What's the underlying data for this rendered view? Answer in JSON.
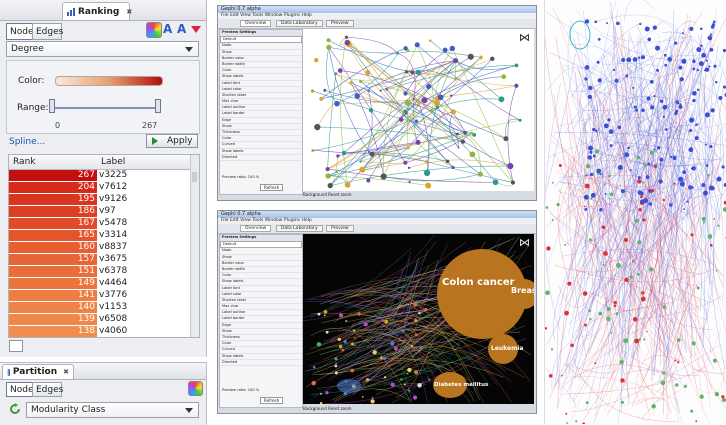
{
  "ranking_panel": {
    "title": "Ranking",
    "close": "✖",
    "tabs": [
      "Nodes",
      "Edges"
    ],
    "attribute": "Degree",
    "color_label": "Color:",
    "range_label": "Range:",
    "range_min": "0",
    "range_max": "267",
    "spline_link": "Spline...",
    "apply_label": "Apply",
    "columns": [
      "Rank",
      "Label"
    ],
    "rows": [
      {
        "rank": "267",
        "label": "v3225",
        "color": "#c40f0f"
      },
      {
        "rank": "204",
        "label": "v7612",
        "color": "#d62a1b"
      },
      {
        "rank": "195",
        "label": "v9126",
        "color": "#da3520"
      },
      {
        "rank": "186",
        "label": "v97",
        "color": "#dd3f23"
      },
      {
        "rank": "167",
        "label": "v5478",
        "color": "#e14b28"
      },
      {
        "rank": "165",
        "label": "v3314",
        "color": "#e4552c"
      },
      {
        "rank": "160",
        "label": "v8837",
        "color": "#e65e31"
      },
      {
        "rank": "157",
        "label": "v3675",
        "color": "#e86635"
      },
      {
        "rank": "151",
        "label": "v6378",
        "color": "#ea6e3a"
      },
      {
        "rank": "149",
        "label": "v4464",
        "color": "#ec753e"
      },
      {
        "rank": "141",
        "label": "v3776",
        "color": "#ee7c43"
      },
      {
        "rank": "140",
        "label": "v1153",
        "color": "#ef8247"
      },
      {
        "rank": "139",
        "label": "v6508",
        "color": "#f0884b"
      },
      {
        "rank": "138",
        "label": "v4060",
        "color": "#f18d4f"
      }
    ]
  },
  "partition_panel": {
    "title": "Partition",
    "close": "✖",
    "tabs": [
      "Nodes",
      "Edges"
    ],
    "attribute": "Modularity Class"
  },
  "screenshot_top": {
    "title": "Gephi 0.7 alpha",
    "menu": "File  Edit  View  Tools  Window  Plugins  Help",
    "toolbar": [
      "Overview",
      "Data Laboratory",
      "Preview"
    ],
    "settings_header": "Preview Settings",
    "preset": "Default",
    "settings": [
      "Node",
      "Show",
      "Border color",
      "Border width",
      "Color",
      "Show labels",
      "Label font",
      "Label color",
      "Shorten label",
      "Max char",
      "Label outline",
      "Label border",
      "Edge",
      "Show",
      "Thickness",
      "Color",
      "Curved",
      "Show labels",
      "Directed"
    ],
    "refresh": "Refresh",
    "ratio": "Preview ratio: 100 %",
    "footer": "Background  Reset zoom"
  },
  "screenshot_bottom": {
    "title": "Gephi 0.7 alpha",
    "menu": "File  Edit  View  Tools  Window  Plugins  Help",
    "toolbar": [
      "Overview",
      "Data Laboratory",
      "Preview"
    ],
    "settings_header": "Preview Settings",
    "preset": "Default",
    "settings": [
      "Node",
      "Show",
      "Border color",
      "Border width",
      "Color",
      "Show labels",
      "Label font",
      "Label color",
      "Shorten label",
      "Max char",
      "Label outline",
      "Label border",
      "Edge",
      "Show",
      "Thickness",
      "Color",
      "Curved",
      "Show labels",
      "Directed"
    ],
    "refresh": "Refresh",
    "ratio": "Preview ratio: 100 %",
    "footer": "Background  Reset zoom",
    "labels": [
      "Colon cancer",
      "Breast",
      "Leukemia",
      "Diabetes mellitus"
    ]
  },
  "colors": {
    "ramp_start": "#fbe7d9",
    "ramp_end": "#b30d0d",
    "dark_bg": "#050505",
    "blue_cluster": "#3a4fd6",
    "red_cluster": "#d9333a"
  }
}
